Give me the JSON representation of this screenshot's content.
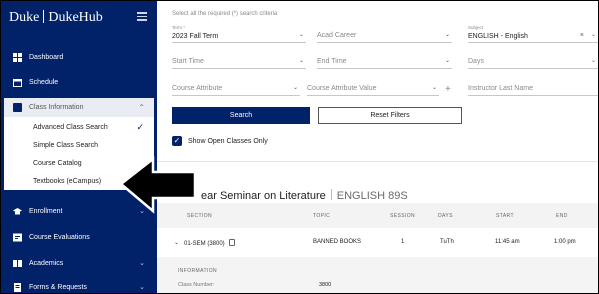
{
  "sidebar": {
    "brand_left": "Duke",
    "brand_right": "DukeHub",
    "items": [
      {
        "label": "Dashboard",
        "icon": "dashboard-icon"
      },
      {
        "label": "Schedule",
        "icon": "calendar-icon"
      }
    ],
    "class_information": {
      "label": "Class Information",
      "subitems": [
        {
          "label": "Advanced Class Search",
          "selected": true
        },
        {
          "label": "Simple Class Search"
        },
        {
          "label": "Course Catalog"
        },
        {
          "label": "Textbooks (eCampus)"
        }
      ]
    },
    "lower_items": [
      {
        "label": "Enrollment",
        "icon": "graduation-cap-icon"
      },
      {
        "label": "Course Evaluations",
        "icon": "evaluation-icon"
      },
      {
        "label": "Academics",
        "icon": "academics-icon"
      },
      {
        "label": "Forms & Requests",
        "icon": "form-icon"
      }
    ]
  },
  "search": {
    "hint": "Select all the required (*) search criteria",
    "term_label": "Term *",
    "term_value": "2023 Fall Term",
    "career_placeholder": "Acad Career",
    "subject_label": "Subject",
    "subject_value": "ENGLISH - English",
    "start_time": "Start Time",
    "end_time": "End Time",
    "days": "Days",
    "course_attribute": "Course Attribute",
    "course_attribute_value": "Course Attribute Value",
    "instructor": "Instructor Last Name",
    "search_button": "Search",
    "reset_button": "Reset Filters",
    "open_only_label": "Show Open Classes Only"
  },
  "results": {
    "course_name": "ear Seminar on Literature",
    "course_code": "ENGLISH 89S",
    "columns": [
      "SECTION",
      "TOPIC",
      "SESSION",
      "DAYS",
      "START",
      "END"
    ],
    "row": {
      "section": "01-SEM (3800)",
      "topic": "BANNED BOOKS",
      "session": "1",
      "days": "TuTh",
      "start": "11:45 am",
      "end": "1:00 pm"
    },
    "info_label": "INFORMATION",
    "class_number_label": "Class Number:",
    "class_number": "3800"
  },
  "colors": {
    "brand_navy": "#012169"
  }
}
